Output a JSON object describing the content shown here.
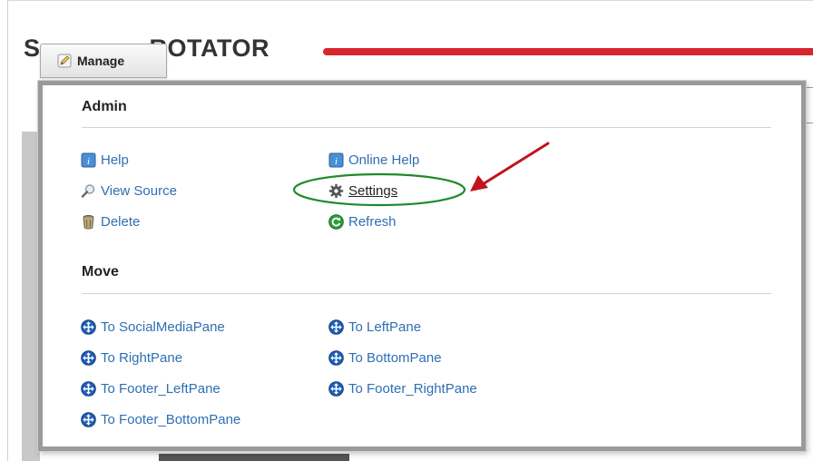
{
  "page": {
    "heading": "SOCIAL ROTATOR",
    "heading_visible_end": "ROTATOR",
    "heading_visible_start": "S"
  },
  "manage_button": {
    "label": "Manage",
    "icon": "pencil-icon"
  },
  "admin": {
    "title": "Admin",
    "items": [
      {
        "label": "Help",
        "icon": "help-book-icon"
      },
      {
        "label": "Online Help",
        "icon": "help-book-icon"
      },
      {
        "label": "View Source",
        "icon": "magnifier-icon"
      },
      {
        "label": "Settings",
        "icon": "gear-icon"
      },
      {
        "label": "Delete",
        "icon": "trash-can-icon"
      },
      {
        "label": "Refresh",
        "icon": "refresh-icon"
      }
    ]
  },
  "move": {
    "title": "Move",
    "items": [
      {
        "label": "To SocialMediaPane",
        "icon": "move-arrows-icon"
      },
      {
        "label": "To LeftPane",
        "icon": "move-arrows-icon"
      },
      {
        "label": "To RightPane",
        "icon": "move-arrows-icon"
      },
      {
        "label": "To BottomPane",
        "icon": "move-arrows-icon"
      },
      {
        "label": "To Footer_LeftPane",
        "icon": "move-arrows-icon"
      },
      {
        "label": "To Footer_RightPane",
        "icon": "move-arrows-icon"
      },
      {
        "label": "To Footer_BottomPane",
        "icon": "move-arrows-icon"
      }
    ]
  },
  "colors": {
    "link": "#2f6fb3",
    "accent_red": "#d6262e",
    "highlight_green": "#1f8a2a",
    "arrow_red": "#c0141c"
  }
}
